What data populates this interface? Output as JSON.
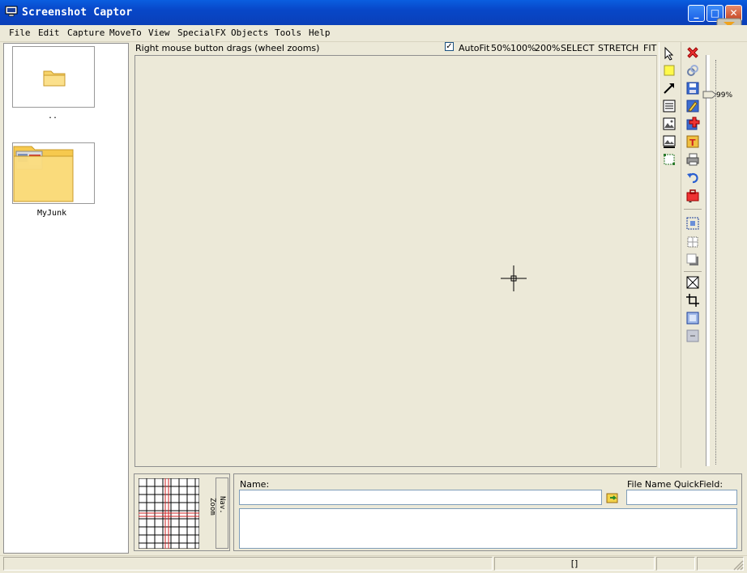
{
  "window": {
    "title": "Screenshot Captor",
    "minimize_glyph": "_",
    "maximize_glyph": "□",
    "close_glyph": "✕"
  },
  "menu": [
    {
      "label": "File"
    },
    {
      "label": "Edit"
    },
    {
      "label": "Capture"
    },
    {
      "label": "MoveTo"
    },
    {
      "label": "View"
    },
    {
      "label": "SpecialFX"
    },
    {
      "label": "Objects"
    },
    {
      "label": "Tools"
    },
    {
      "label": "Help"
    }
  ],
  "browser": {
    "items": [
      {
        "label": "..",
        "icon": "folder-icon"
      },
      {
        "label": "MyJunk",
        "icon": "folder-with-screenshot-icon"
      }
    ]
  },
  "canvas_header": {
    "hint": "Right mouse button drags (wheel zooms)",
    "autofit_checked": true,
    "autofit_label": "AutoFit",
    "zoom_options": [
      "50%",
      "100%",
      "200%",
      "SELECT",
      "STRETCH",
      "FIT"
    ]
  },
  "toolbar_left": [
    "pointer-icon",
    "highlight-icon",
    "arrow-icon",
    "text-note-icon",
    "image-icon",
    "image-stamp-icon",
    "selection-rect-icon"
  ],
  "toolbar_right": [
    "delete-icon",
    "link-icon",
    "save-icon",
    "edit-icon",
    "add-icon",
    "text-tool-icon",
    "print-icon",
    "undo-icon",
    "tool-box-icon",
    "select-region-icon",
    "grid-select-icon",
    "shadow-icon",
    "resize-icon",
    "crop-icon",
    "border-icon",
    "collapse-icon"
  ],
  "zoom_slider": {
    "value_label": "99%"
  },
  "nav": {
    "nav_label": "Nav.",
    "zoom_label": "Zoom"
  },
  "file_panel": {
    "name_label": "Name:",
    "name_value": "",
    "quickfield_label": "File Name QuickField:",
    "quickfield_value": "",
    "notes_value": ""
  },
  "status": {
    "segment3": "[]"
  },
  "colors": {
    "titlebar": "#0a5ee0",
    "chrome": "#ece9d8",
    "nav_grid_marker": "#d02020"
  }
}
